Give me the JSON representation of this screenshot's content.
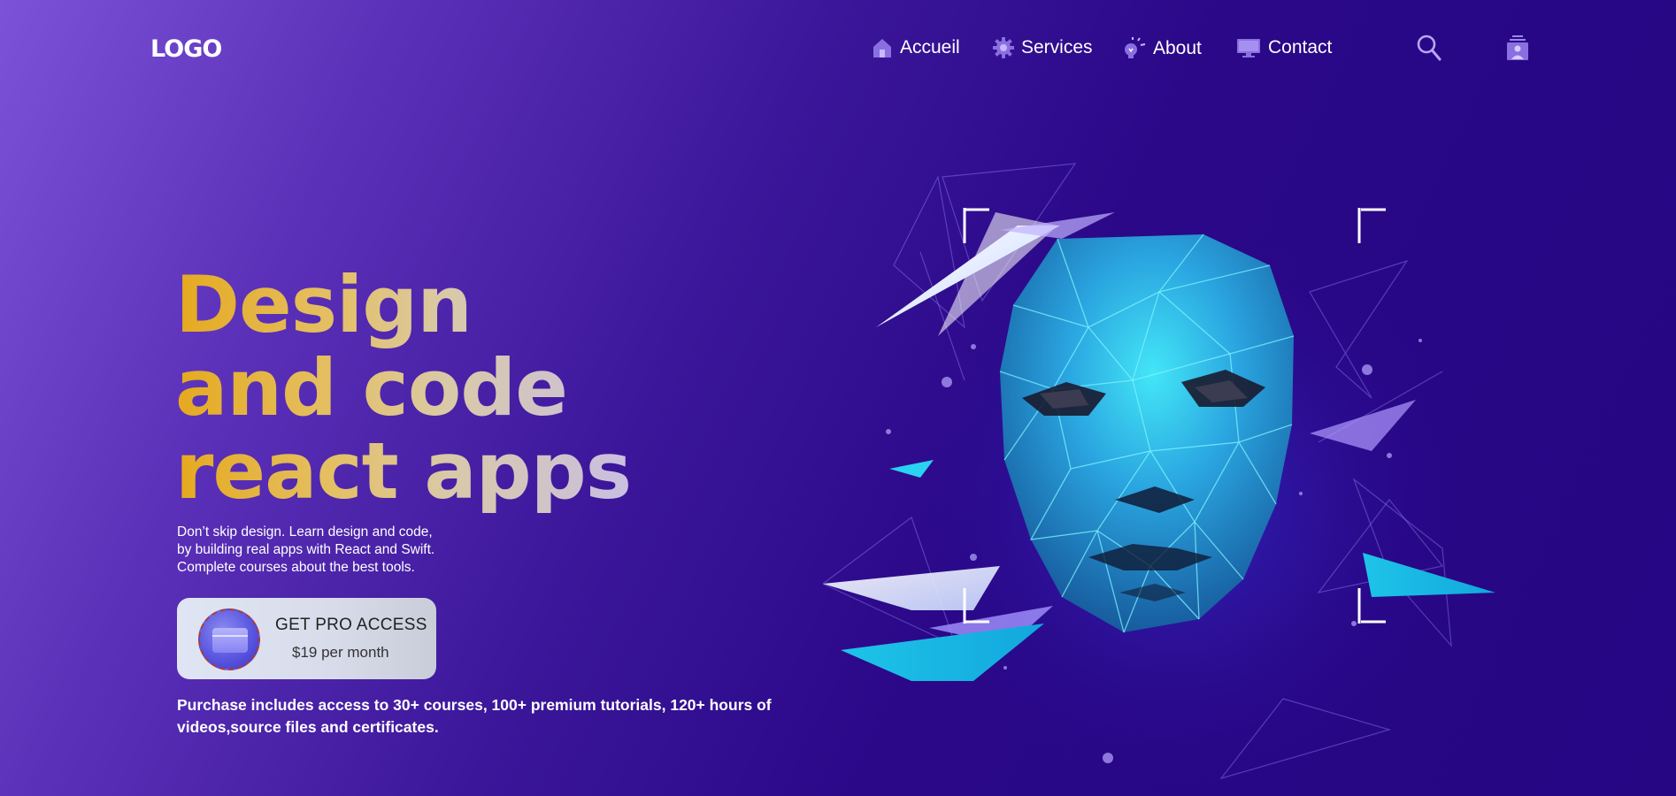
{
  "nav": {
    "logo": "LOGO",
    "links": [
      {
        "label": "Accueil",
        "icon": "home-icon"
      },
      {
        "label": "Services",
        "icon": "gear-icon"
      },
      {
        "label": "About",
        "icon": "lightbulb-icon"
      },
      {
        "label": "Contact",
        "icon": "monitor-icon"
      }
    ],
    "actions": [
      {
        "icon": "search-icon"
      },
      {
        "icon": "user-badge-icon"
      }
    ]
  },
  "hero": {
    "title_lines": [
      "Design",
      "and code",
      "react apps"
    ],
    "description_lines": [
      "Don’t skip design. Learn design and code,",
      "by building real apps with React and Swift.",
      "Complete courses about the best tools."
    ],
    "cta": {
      "title": "GET PRO ACCESS",
      "price": "$19 per month",
      "icon": "credit-card-icon"
    },
    "purchase_lines": [
      "Purchase includes access to 30+ courses, 100+ premium tutorials, 120+ hours of",
      "videos,source files and certificates."
    ],
    "illustration": "low-poly-face-illustration"
  },
  "colors": {
    "background_start": "#7c52d8",
    "background_end": "#260683",
    "title_gold": "#e5a91e",
    "face_cyan": "#2fb8ef"
  }
}
